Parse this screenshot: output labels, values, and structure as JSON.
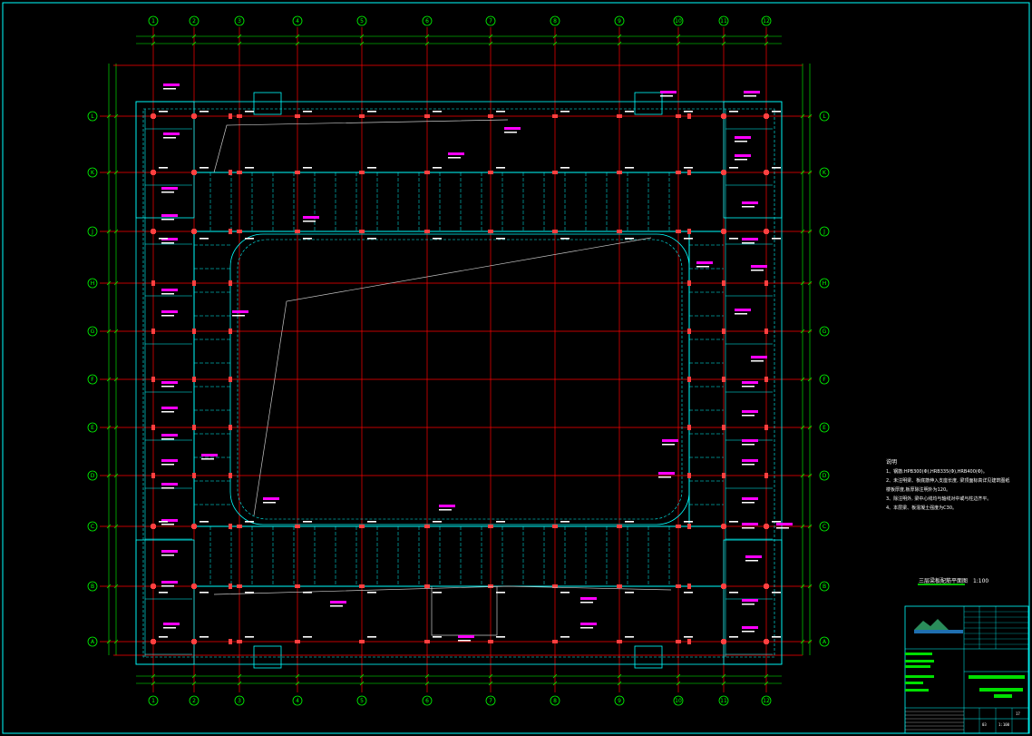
{
  "plan": {
    "grid_x_labels": [
      "1",
      "2",
      "3",
      "4",
      "5",
      "6",
      "7",
      "8",
      "9",
      "10",
      "11",
      "12"
    ],
    "grid_y_labels": [
      "L",
      "K",
      "J",
      "H",
      "G",
      "F",
      "E",
      "D",
      "C",
      "B",
      "A"
    ],
    "colors": {
      "background": "#000000",
      "frame": "#00ffff",
      "grid": "#ff0000",
      "wall": "#00ffff",
      "dimension": "#00ff00",
      "annotation": "#ff00ff",
      "leader": "#c8c8c8",
      "column": "#ff4040"
    }
  },
  "notes": {
    "title": "说明",
    "lines": [
      "1、钢筋:HPB300(Φ),HRB335(Φ),HRB400(Φ)。",
      "2、未注明梁、板底筋伸入支座长度, 梁顶面标高详见建筑图纸",
      "   楼板厚度,板厚除注明外为120。",
      "3、除注明外, 梁中心线均与轴线对中或与柱边齐平。",
      "4、本层梁、板混凝土强度为C30。"
    ]
  },
  "plan_title": {
    "text": "三层梁板配筋平面图",
    "scale": "1:100"
  },
  "title_block": {
    "sheet_no": "03",
    "total": "17",
    "scale": "1:100"
  },
  "icons": {
    "logo": "company-logo-icon"
  }
}
